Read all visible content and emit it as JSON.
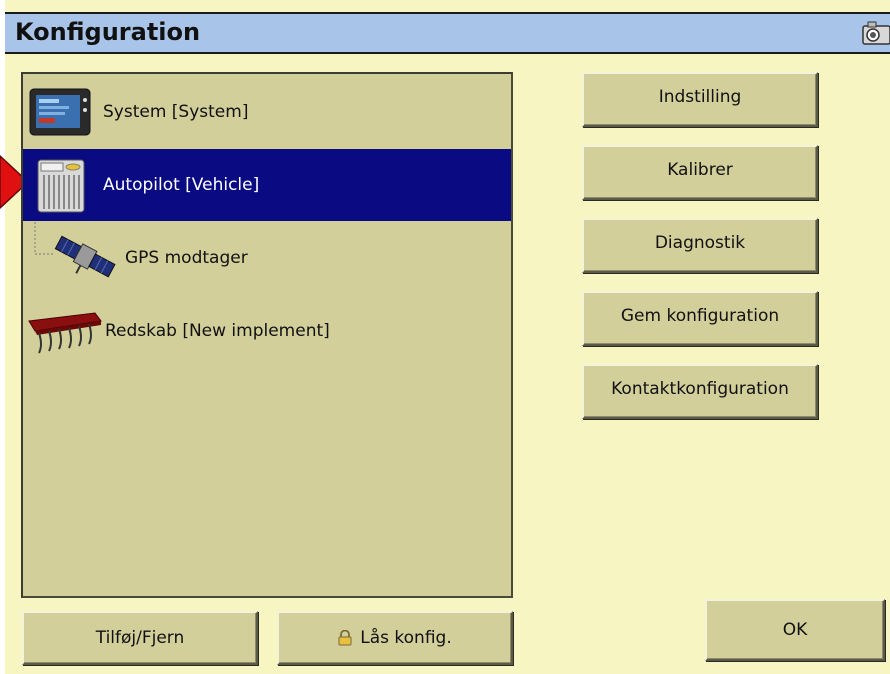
{
  "window": {
    "title": "Konfiguration",
    "camera_icon": "camera-icon"
  },
  "tree": {
    "items": [
      {
        "label": "System [System]",
        "icon": "display-console-icon",
        "selected": false
      },
      {
        "label": "Autopilot [Vehicle]",
        "icon": "controller-module-icon",
        "selected": true
      },
      {
        "label": "GPS modtager",
        "icon": "satellite-icon",
        "selected": false
      },
      {
        "label": "Redskab [New implement]",
        "icon": "implement-cultivator-icon",
        "selected": false
      }
    ]
  },
  "actions": {
    "setup": "Indstilling",
    "calibrate": "Kalibrer",
    "diagnostics": "Diagnostik",
    "save_config": "Gem konfiguration",
    "connector_config": "Kontaktkonfiguration"
  },
  "bottom": {
    "add_remove": "Tilføj/Fjern",
    "lock_config": "Lås konfig.",
    "ok": "OK"
  },
  "colors": {
    "background": "#f7f5c2",
    "titlebar": "#a8c4e8",
    "panel": "#d3cf9a",
    "selection": "#0a0a82",
    "pointer_arrow": "#e01010"
  }
}
